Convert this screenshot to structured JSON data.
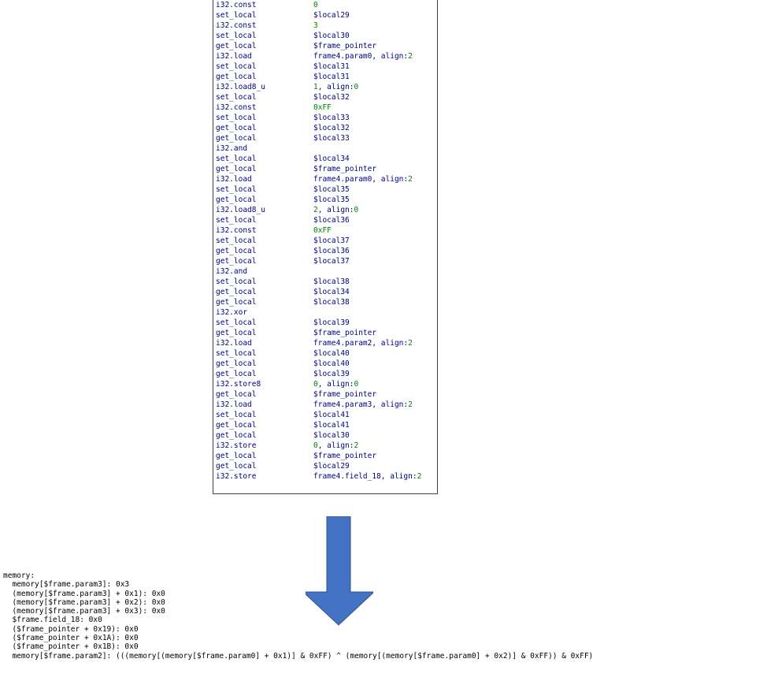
{
  "instructions": [
    {
      "op": "i32.const",
      "arg": "0",
      "kind": "num"
    },
    {
      "op": "set_local",
      "arg": "$local29",
      "kind": "ref"
    },
    {
      "op": "i32.const",
      "arg": "3",
      "kind": "num"
    },
    {
      "op": "set_local",
      "arg": "$local30",
      "kind": "ref"
    },
    {
      "op": "get_local",
      "arg": "$frame_pointer",
      "kind": "ref"
    },
    {
      "op": "i32.load",
      "arg": "frame4.param0, align:2",
      "kind": "load"
    },
    {
      "op": "set_local",
      "arg": "$local31",
      "kind": "ref"
    },
    {
      "op": "get_local",
      "arg": "$local31",
      "kind": "ref"
    },
    {
      "op": "i32.load8_u",
      "arg": "1, align:0",
      "kind": "num"
    },
    {
      "op": "set_local",
      "arg": "$local32",
      "kind": "ref"
    },
    {
      "op": "i32.const",
      "arg": "0xFF",
      "kind": "num"
    },
    {
      "op": "set_local",
      "arg": "$local33",
      "kind": "ref"
    },
    {
      "op": "get_local",
      "arg": "$local32",
      "kind": "ref"
    },
    {
      "op": "get_local",
      "arg": "$local33",
      "kind": "ref"
    },
    {
      "op": "i32.and",
      "arg": "",
      "kind": "ref"
    },
    {
      "op": "set_local",
      "arg": "$local34",
      "kind": "ref"
    },
    {
      "op": "get_local",
      "arg": "$frame_pointer",
      "kind": "ref"
    },
    {
      "op": "i32.load",
      "arg": "frame4.param0, align:2",
      "kind": "load"
    },
    {
      "op": "set_local",
      "arg": "$local35",
      "kind": "ref"
    },
    {
      "op": "get_local",
      "arg": "$local35",
      "kind": "ref"
    },
    {
      "op": "i32.load8_u",
      "arg": "2, align:0",
      "kind": "num"
    },
    {
      "op": "set_local",
      "arg": "$local36",
      "kind": "ref"
    },
    {
      "op": "i32.const",
      "arg": "0xFF",
      "kind": "num"
    },
    {
      "op": "set_local",
      "arg": "$local37",
      "kind": "ref"
    },
    {
      "op": "get_local",
      "arg": "$local36",
      "kind": "ref"
    },
    {
      "op": "get_local",
      "arg": "$local37",
      "kind": "ref"
    },
    {
      "op": "i32.and",
      "arg": "",
      "kind": "ref"
    },
    {
      "op": "set_local",
      "arg": "$local38",
      "kind": "ref"
    },
    {
      "op": "get_local",
      "arg": "$local34",
      "kind": "ref"
    },
    {
      "op": "get_local",
      "arg": "$local38",
      "kind": "ref"
    },
    {
      "op": "i32.xor",
      "arg": "",
      "kind": "ref"
    },
    {
      "op": "set_local",
      "arg": "$local39",
      "kind": "ref"
    },
    {
      "op": "get_local",
      "arg": "$frame_pointer",
      "kind": "ref"
    },
    {
      "op": "i32.load",
      "arg": "frame4.param2, align:2",
      "kind": "load"
    },
    {
      "op": "set_local",
      "arg": "$local40",
      "kind": "ref"
    },
    {
      "op": "get_local",
      "arg": "$local40",
      "kind": "ref"
    },
    {
      "op": "get_local",
      "arg": "$local39",
      "kind": "ref"
    },
    {
      "op": "i32.store8",
      "arg": "0, align:0",
      "kind": "num"
    },
    {
      "op": "get_local",
      "arg": "$frame_pointer",
      "kind": "ref"
    },
    {
      "op": "i32.load",
      "arg": "frame4.param3, align:2",
      "kind": "load"
    },
    {
      "op": "set_local",
      "arg": "$local41",
      "kind": "ref"
    },
    {
      "op": "get_local",
      "arg": "$local41",
      "kind": "ref"
    },
    {
      "op": "get_local",
      "arg": "$local30",
      "kind": "ref"
    },
    {
      "op": "i32.store",
      "arg": "0, align:2",
      "kind": "num"
    },
    {
      "op": "get_local",
      "arg": "$frame_pointer",
      "kind": "ref"
    },
    {
      "op": "get_local",
      "arg": "$local29",
      "kind": "ref"
    },
    {
      "op": "i32.store",
      "arg": "frame4.field_18, align:2",
      "kind": "load"
    }
  ],
  "memory": {
    "header": "memory:",
    "lines": [
      "  memory[$frame.param3]: 0x3",
      "  (memory[$frame.param3] + 0x1): 0x0",
      "  (memory[$frame.param3] + 0x2): 0x0",
      "  (memory[$frame.param3] + 0x3): 0x0",
      "  $frame.field_18: 0x0",
      "  ($frame_pointer + 0x19): 0x0",
      "  ($frame_pointer + 0x1A): 0x0",
      "  ($frame_pointer + 0x1B): 0x0",
      "  memory[$frame.param2]: (((memory[(memory[$frame.param0] + 0x1)] & 0xFF) ^ (memory[(memory[$frame.param0] + 0x2)] & 0xFF)) & 0xFF)"
    ]
  },
  "colors": {
    "opcode": "#000080",
    "number": "#008000",
    "reference": "#000080",
    "arrow": "#4472C4"
  }
}
